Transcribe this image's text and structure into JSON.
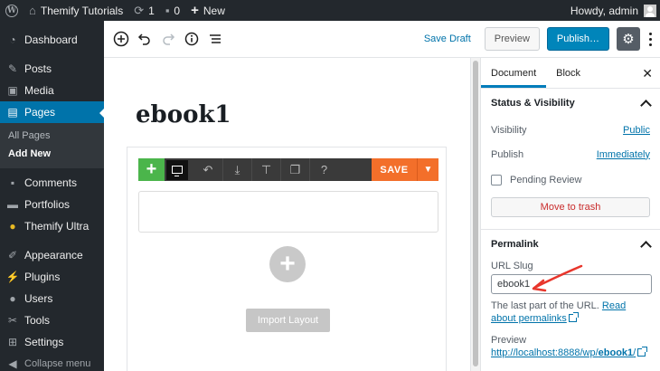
{
  "adminbar": {
    "site_name": "Themify Tutorials",
    "updates_count": "1",
    "comments_count": "0",
    "new_label": "New",
    "howdy": "Howdy, admin"
  },
  "sidebar": {
    "items": [
      {
        "label": "Dashboard",
        "icon": "gauge-icon"
      },
      {
        "label": "Posts",
        "icon": "pin-icon"
      },
      {
        "label": "Media",
        "icon": "media-icon"
      },
      {
        "label": "Pages",
        "icon": "page-icon"
      },
      {
        "label": "Comments",
        "icon": "comment-icon"
      },
      {
        "label": "Portfolios",
        "icon": "portfolio-icon"
      },
      {
        "label": "Themify Ultra",
        "icon": "themify-icon"
      },
      {
        "label": "Appearance",
        "icon": "brush-icon"
      },
      {
        "label": "Plugins",
        "icon": "plug-icon"
      },
      {
        "label": "Users",
        "icon": "user-icon"
      },
      {
        "label": "Tools",
        "icon": "wrench-icon"
      },
      {
        "label": "Settings",
        "icon": "settings-icon"
      }
    ],
    "submenu": [
      "All Pages",
      "Add New"
    ],
    "collapse_label": "Collapse menu"
  },
  "editor": {
    "save_draft": "Save Draft",
    "preview": "Preview",
    "publish": "Publish…"
  },
  "content": {
    "title": "ebook1",
    "builder_save": "SAVE",
    "builder_help": "?",
    "import_layout": "Import Layout"
  },
  "panel": {
    "tabs": [
      "Document",
      "Block"
    ],
    "status_heading": "Status & Visibility",
    "visibility_label": "Visibility",
    "visibility_value": "Public",
    "publish_label": "Publish",
    "publish_value": "Immediately",
    "pending_review": "Pending Review",
    "move_to_trash": "Move to trash",
    "permalink_heading": "Permalink",
    "url_slug_label": "URL Slug",
    "url_slug_value": "ebook1",
    "help_text": "The last part of the URL.",
    "read_about": "Read about permalinks",
    "preview_label": "Preview",
    "preview_url_prefix": "http://localhost:8888/wp/",
    "preview_url_slug": "ebook1",
    "preview_url_suffix": "/"
  },
  "colors": {
    "admin_dark": "#23282d",
    "wp_blue": "#0073aa",
    "builder_green": "#4bb54b",
    "builder_orange": "#f36f2a",
    "annotation_red": "#e8362c"
  }
}
